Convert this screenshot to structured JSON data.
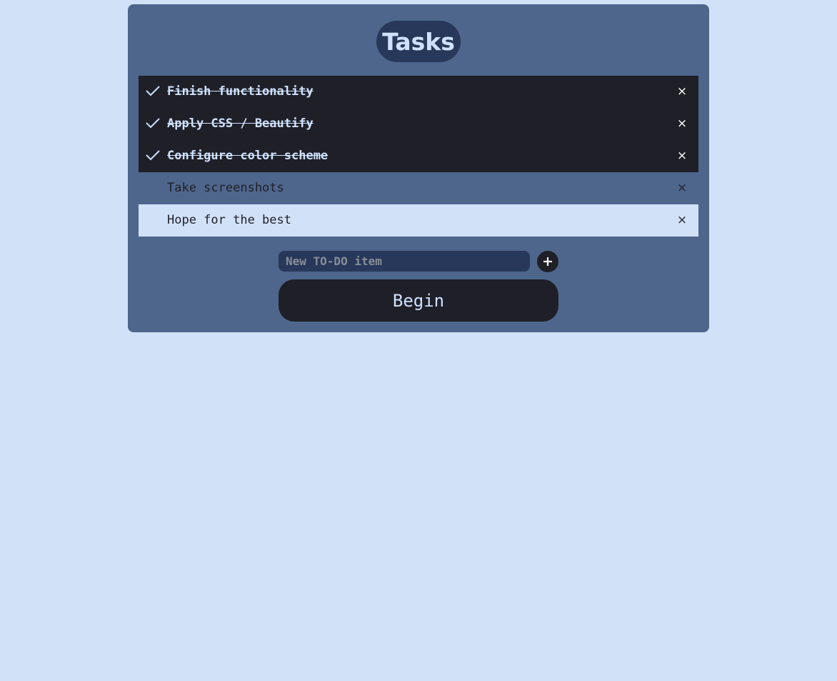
{
  "header": {
    "title": "Tasks"
  },
  "tasks": [
    {
      "text": "Finish functionality",
      "done": true,
      "remove_label": "×"
    },
    {
      "text": "Apply CSS / Beautify",
      "done": true,
      "remove_label": "×"
    },
    {
      "text": "Configure color scheme",
      "done": true,
      "remove_label": "×"
    },
    {
      "text": "Take screenshots",
      "done": false,
      "remove_label": "×"
    },
    {
      "text": "Hope for the best",
      "done": false,
      "remove_label": "×"
    }
  ],
  "new_item": {
    "placeholder": "New TO-DO item",
    "value": ""
  },
  "actions": {
    "begin_label": "Begin"
  },
  "icons": {
    "check": "checkmark-icon",
    "remove": "close-icon",
    "add": "plus-icon"
  },
  "colors": {
    "page_background": "#d1e1f8",
    "panel": "#4e668c",
    "dark": "#1f1f27",
    "accent_text": "#cfe2ff",
    "title_pill": "#27385a"
  }
}
